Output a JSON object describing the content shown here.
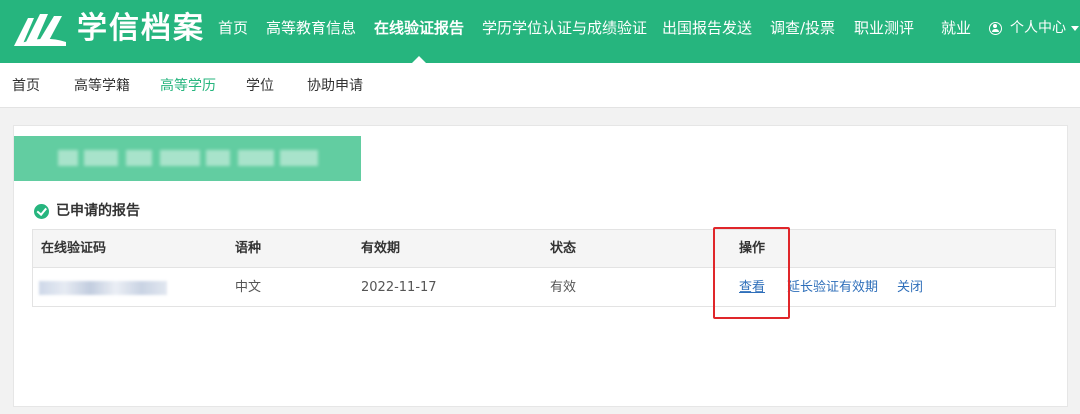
{
  "header": {
    "brand": "学信档案",
    "nav": [
      {
        "label": "首页"
      },
      {
        "label": "高等教育信息"
      },
      {
        "label": "在线验证报告",
        "active": true
      },
      {
        "label": "学历学位认证与成绩验证"
      },
      {
        "label": "出国报告发送"
      },
      {
        "label": "调查/投票"
      },
      {
        "label": "职业测评"
      },
      {
        "label": "就业"
      }
    ],
    "user_menu": "个人中心",
    "icons": [
      "logo-icon",
      "user-icon",
      "chevron-down-icon"
    ],
    "colors": {
      "brand_green": "#26b57e",
      "header_text": "#ffffff"
    }
  },
  "subnav": {
    "items": [
      {
        "label": "首页"
      },
      {
        "label": "高等学籍"
      },
      {
        "label": "高等学历",
        "active": true
      },
      {
        "label": "学位"
      },
      {
        "label": "协助申请"
      }
    ]
  },
  "main": {
    "section_title": "已申请的报告",
    "section_icon": "check-circle-icon",
    "table": {
      "columns": [
        "在线验证码",
        "语种",
        "有效期",
        "状态",
        "操作"
      ],
      "rows": [
        {
          "language": "中文",
          "expiry": "2022-11-17",
          "status": "有效",
          "actions": [
            "查看",
            "延长验证有效期",
            "关闭"
          ]
        }
      ]
    },
    "colors": {
      "link": "#2f6fba",
      "annotation_box": "#e0262a"
    }
  }
}
